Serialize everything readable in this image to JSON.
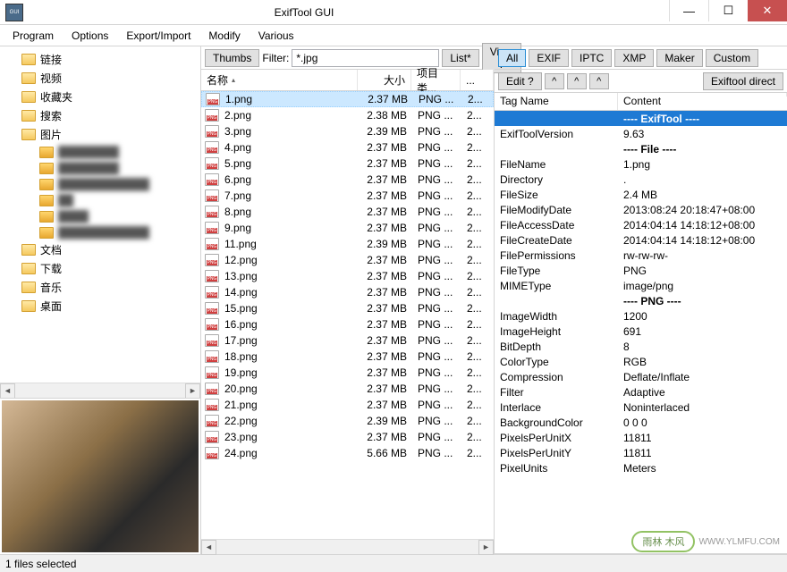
{
  "window": {
    "title": "ExifTool GUI"
  },
  "menu": {
    "items": [
      "Program",
      "Options",
      "Export/Import",
      "Modify",
      "Various"
    ]
  },
  "tree": {
    "items": [
      {
        "label": "链接",
        "sub": false
      },
      {
        "label": "视频",
        "sub": false
      },
      {
        "label": "收藏夹",
        "sub": false
      },
      {
        "label": "搜索",
        "sub": false
      },
      {
        "label": "图片",
        "sub": false
      },
      {
        "label": "████████",
        "sub": true,
        "blur": true
      },
      {
        "label": "████████",
        "sub": true,
        "blur": true
      },
      {
        "label": "████████████",
        "sub": true,
        "blur": true
      },
      {
        "label": "██",
        "sub": true,
        "blur": true
      },
      {
        "label": "████",
        "sub": true,
        "blur": true
      },
      {
        "label": "████████████",
        "sub": true,
        "blur": true
      },
      {
        "label": "文档",
        "sub": false
      },
      {
        "label": "下载",
        "sub": false
      },
      {
        "label": "音乐",
        "sub": false
      },
      {
        "label": "桌面",
        "sub": false
      }
    ]
  },
  "mid_toolbar": {
    "thumbs": "Thumbs",
    "filter_label": "Filter:",
    "filter_value": "*.jpg",
    "list": "List*",
    "view": "View ?"
  },
  "file_headers": {
    "name": "名称",
    "size": "大小",
    "type": "项目类...",
    "date": "..."
  },
  "files": [
    {
      "name": "1.png",
      "size": "2.37 MB",
      "type": "PNG ...",
      "date": "2...",
      "selected": true
    },
    {
      "name": "2.png",
      "size": "2.38 MB",
      "type": "PNG ...",
      "date": "2..."
    },
    {
      "name": "3.png",
      "size": "2.39 MB",
      "type": "PNG ...",
      "date": "2..."
    },
    {
      "name": "4.png",
      "size": "2.37 MB",
      "type": "PNG ...",
      "date": "2..."
    },
    {
      "name": "5.png",
      "size": "2.37 MB",
      "type": "PNG ...",
      "date": "2..."
    },
    {
      "name": "6.png",
      "size": "2.37 MB",
      "type": "PNG ...",
      "date": "2..."
    },
    {
      "name": "7.png",
      "size": "2.37 MB",
      "type": "PNG ...",
      "date": "2..."
    },
    {
      "name": "8.png",
      "size": "2.37 MB",
      "type": "PNG ...",
      "date": "2..."
    },
    {
      "name": "9.png",
      "size": "2.37 MB",
      "type": "PNG ...",
      "date": "2..."
    },
    {
      "name": "11.png",
      "size": "2.39 MB",
      "type": "PNG ...",
      "date": "2..."
    },
    {
      "name": "12.png",
      "size": "2.37 MB",
      "type": "PNG ...",
      "date": "2..."
    },
    {
      "name": "13.png",
      "size": "2.37 MB",
      "type": "PNG ...",
      "date": "2..."
    },
    {
      "name": "14.png",
      "size": "2.37 MB",
      "type": "PNG ...",
      "date": "2..."
    },
    {
      "name": "15.png",
      "size": "2.37 MB",
      "type": "PNG ...",
      "date": "2..."
    },
    {
      "name": "16.png",
      "size": "2.37 MB",
      "type": "PNG ...",
      "date": "2..."
    },
    {
      "name": "17.png",
      "size": "2.37 MB",
      "type": "PNG ...",
      "date": "2..."
    },
    {
      "name": "18.png",
      "size": "2.37 MB",
      "type": "PNG ...",
      "date": "2..."
    },
    {
      "name": "19.png",
      "size": "2.37 MB",
      "type": "PNG ...",
      "date": "2..."
    },
    {
      "name": "20.png",
      "size": "2.37 MB",
      "type": "PNG ...",
      "date": "2..."
    },
    {
      "name": "21.png",
      "size": "2.37 MB",
      "type": "PNG ...",
      "date": "2..."
    },
    {
      "name": "22.png",
      "size": "2.39 MB",
      "type": "PNG ...",
      "date": "2..."
    },
    {
      "name": "23.png",
      "size": "2.37 MB",
      "type": "PNG ...",
      "date": "2..."
    },
    {
      "name": "24.png",
      "size": "5.66 MB",
      "type": "PNG ...",
      "date": "2..."
    }
  ],
  "right_toolbar1": {
    "tabs": [
      "All",
      "EXIF",
      "IPTC",
      "XMP",
      "Maker",
      "Custom"
    ],
    "active": "All"
  },
  "right_toolbar2": {
    "edit": "Edit ?",
    "exiftool_direct": "Exiftool direct"
  },
  "meta_headers": {
    "tag": "Tag Name",
    "content": "Content"
  },
  "metadata": [
    {
      "tag": "",
      "content": "---- ExifTool ----",
      "selected": true,
      "bold": true
    },
    {
      "tag": "ExifToolVersion",
      "content": "9.63"
    },
    {
      "tag": "",
      "content": "---- File ----",
      "bold": true
    },
    {
      "tag": "FileName",
      "content": "1.png"
    },
    {
      "tag": "Directory",
      "content": "."
    },
    {
      "tag": "FileSize",
      "content": "2.4 MB"
    },
    {
      "tag": "FileModifyDate",
      "content": "2013:08:24 20:18:47+08:00"
    },
    {
      "tag": "FileAccessDate",
      "content": "2014:04:14 14:18:12+08:00"
    },
    {
      "tag": "FileCreateDate",
      "content": "2014:04:14 14:18:12+08:00"
    },
    {
      "tag": "FilePermissions",
      "content": "rw-rw-rw-"
    },
    {
      "tag": "FileType",
      "content": "PNG"
    },
    {
      "tag": "MIMEType",
      "content": "image/png"
    },
    {
      "tag": "",
      "content": "---- PNG ----",
      "bold": true
    },
    {
      "tag": "ImageWidth",
      "content": "1200"
    },
    {
      "tag": "ImageHeight",
      "content": "691"
    },
    {
      "tag": "BitDepth",
      "content": "8"
    },
    {
      "tag": "ColorType",
      "content": "RGB"
    },
    {
      "tag": "Compression",
      "content": "Deflate/Inflate"
    },
    {
      "tag": "Filter",
      "content": "Adaptive"
    },
    {
      "tag": "Interlace",
      "content": "Noninterlaced"
    },
    {
      "tag": "BackgroundColor",
      "content": "0 0 0"
    },
    {
      "tag": "PixelsPerUnitX",
      "content": "11811"
    },
    {
      "tag": "PixelsPerUnitY",
      "content": "11811"
    },
    {
      "tag": "PixelUnits",
      "content": "Meters"
    }
  ],
  "statusbar": {
    "text": "1 files selected"
  },
  "watermark": {
    "badge": "雨林 木风",
    "url": "WWW.YLMFU.COM"
  }
}
